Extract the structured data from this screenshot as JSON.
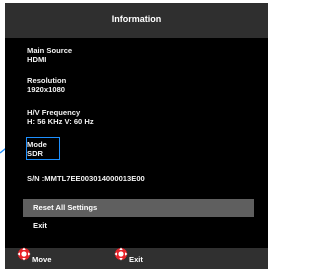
{
  "osd": {
    "title": "Information",
    "fields": [
      {
        "label": "Main Source",
        "value": "HDMI"
      },
      {
        "label": "Resolution",
        "value": "1920x1080"
      },
      {
        "label": "H/V Frequency",
        "value": "H: 56 KHz  V: 60 Hz"
      },
      {
        "label": "Mode",
        "value": "SDR"
      }
    ],
    "serial": "S/N :MMTL7EE003014000013E00",
    "menu": [
      {
        "label": "Reset All Settings",
        "selected": true
      },
      {
        "label": "Exit",
        "selected": false
      }
    ],
    "footer": {
      "move_label": "Move",
      "exit_label": "Exit"
    }
  },
  "colors": {
    "highlight_box": "#1e90ff",
    "dpad_accent": "#e8232a",
    "selected_bg": "#5f5f5f"
  }
}
